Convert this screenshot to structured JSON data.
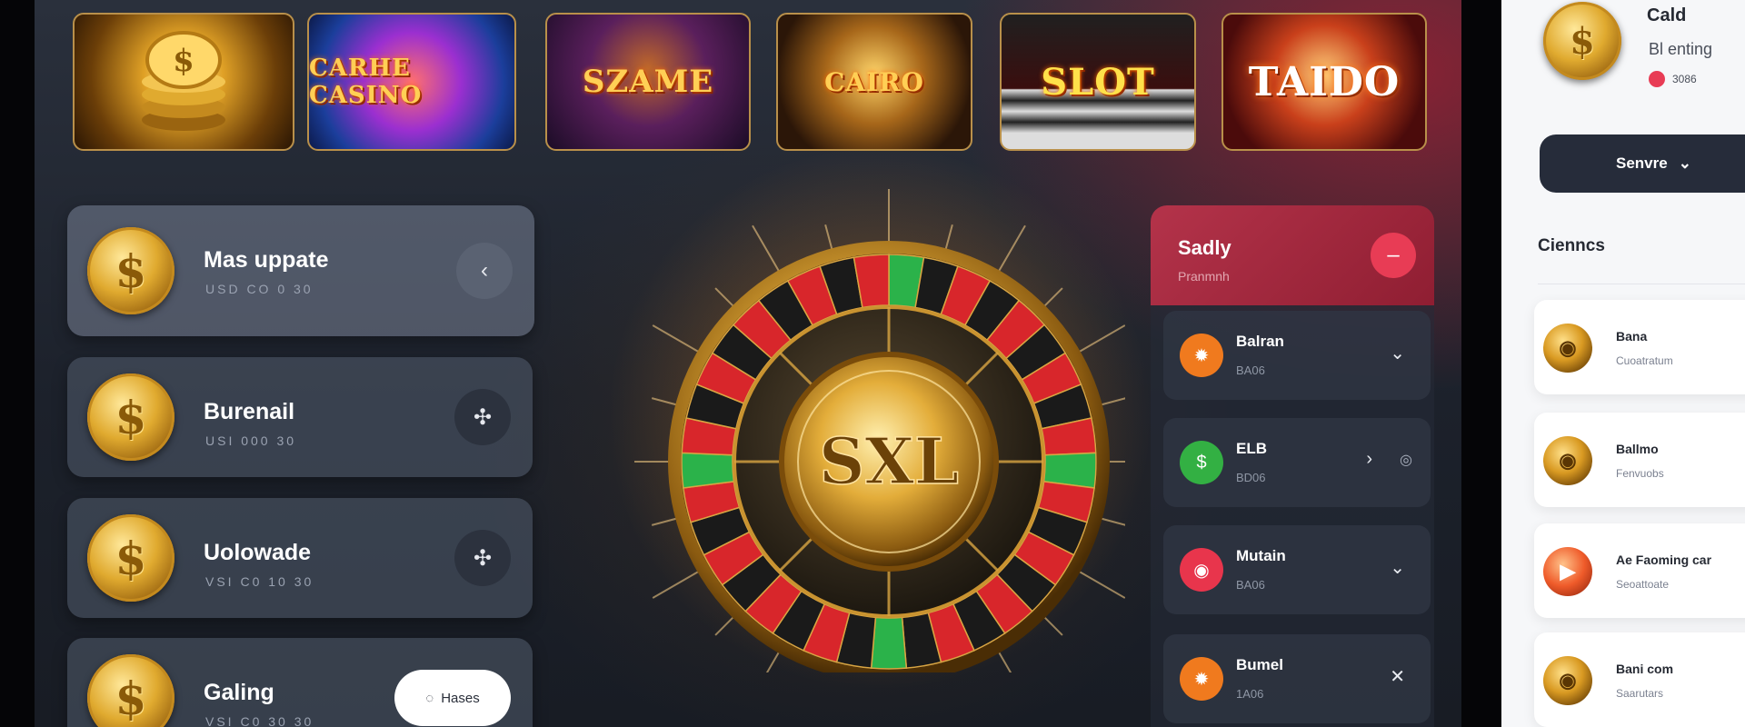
{
  "thumbnails": [
    {
      "name": "coins",
      "text": ""
    },
    {
      "name": "casino",
      "text": "CARHE CASINO"
    },
    {
      "name": "szame",
      "text": "SZAME"
    },
    {
      "name": "cairo",
      "text": "CAIRO"
    },
    {
      "name": "slots",
      "text": "SLOT"
    },
    {
      "name": "taido",
      "text": "TAIDO"
    }
  ],
  "left_cards": [
    {
      "title": "Mas uppate",
      "sub": "USD CO 0 30",
      "coin": "$",
      "action_icon": "‹",
      "active": true
    },
    {
      "title": "Burenail",
      "sub": "USI 000 30",
      "coin": "$",
      "action_icon": "✣"
    },
    {
      "title": "Uolowade",
      "sub": "VSI C0 10 30",
      "coin": "$",
      "action_icon": "✣"
    },
    {
      "title": "Galing",
      "sub": "VSI C0 30 30",
      "coin": "$",
      "pill_label": "Hases",
      "pill_icon": "◌"
    }
  ],
  "wheel": {
    "center_text": "SXL"
  },
  "right_panel": {
    "title": "Sadly",
    "subtitle": "Pranmnh",
    "header_icon": "–",
    "items": [
      {
        "title": "Balran",
        "sub": "BA06",
        "icon": "✹",
        "icon_color": "#f07a1e",
        "chevron": "⌄"
      },
      {
        "title": "ELB",
        "sub": "BD06",
        "icon": "$",
        "icon_color": "#33b043",
        "chevron": "›",
        "extra": "◎"
      },
      {
        "title": "Mutain",
        "sub": "BA06",
        "icon": "◉",
        "icon_color": "#e8354c",
        "chevron": "⌄"
      },
      {
        "title": "Bumel",
        "sub": "1A06",
        "icon": "✹",
        "icon_color": "#f07a1e",
        "chevron": "✕"
      }
    ]
  },
  "sidebar": {
    "user_name": "Cald",
    "user_status": "Bl enting",
    "user_count": "3086",
    "select_label": "Senvre",
    "section_title": "Cienncs",
    "items": [
      {
        "title": "Bana",
        "sub": "Cuoatratum",
        "icon": "◉"
      },
      {
        "title": "Ballmo",
        "sub": "Fenvuobs",
        "icon": "◉"
      },
      {
        "title": "Ae Faoming car",
        "sub": "Seoattoate",
        "icon": "▶",
        "red": true
      },
      {
        "title": "Bani com",
        "sub": "Saarutars",
        "icon": "◉"
      }
    ]
  },
  "colors": {
    "accent_red": "#e83c55",
    "gold": "#e0aa2f",
    "panel_dark": "#262c3a"
  }
}
